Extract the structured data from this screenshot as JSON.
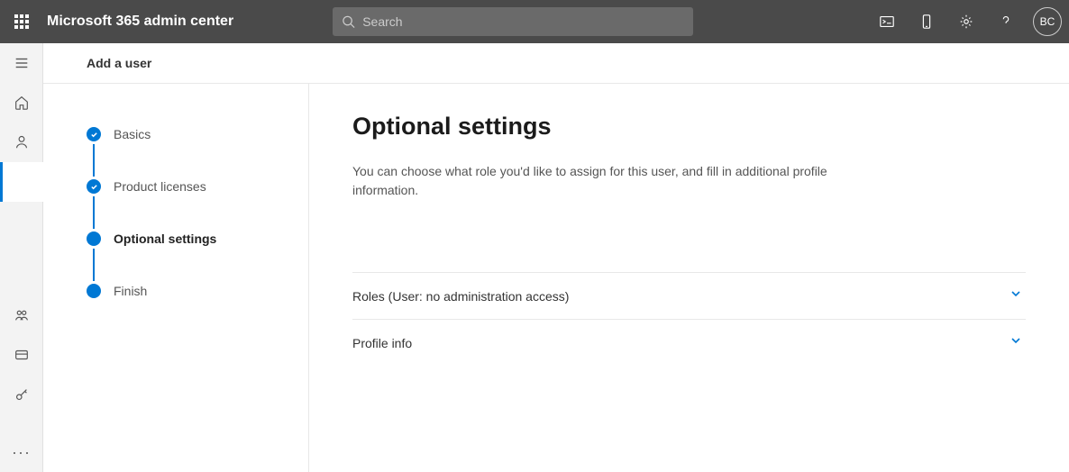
{
  "header": {
    "app_title": "Microsoft 365 admin center",
    "search_placeholder": "Search",
    "avatar_initials": "BC"
  },
  "sub_header": {
    "title": "Add a user"
  },
  "wizard": {
    "steps": [
      {
        "label": "Basics",
        "state": "completed"
      },
      {
        "label": "Product licenses",
        "state": "completed"
      },
      {
        "label": "Optional settings",
        "state": "current"
      },
      {
        "label": "Finish",
        "state": "upcoming"
      }
    ]
  },
  "panel": {
    "title": "Optional settings",
    "description": "You can choose what role you'd like to assign for this user, and fill in additional profile information.",
    "sections": [
      {
        "label": "Roles (User: no administration access)"
      },
      {
        "label": "Profile info"
      }
    ]
  }
}
